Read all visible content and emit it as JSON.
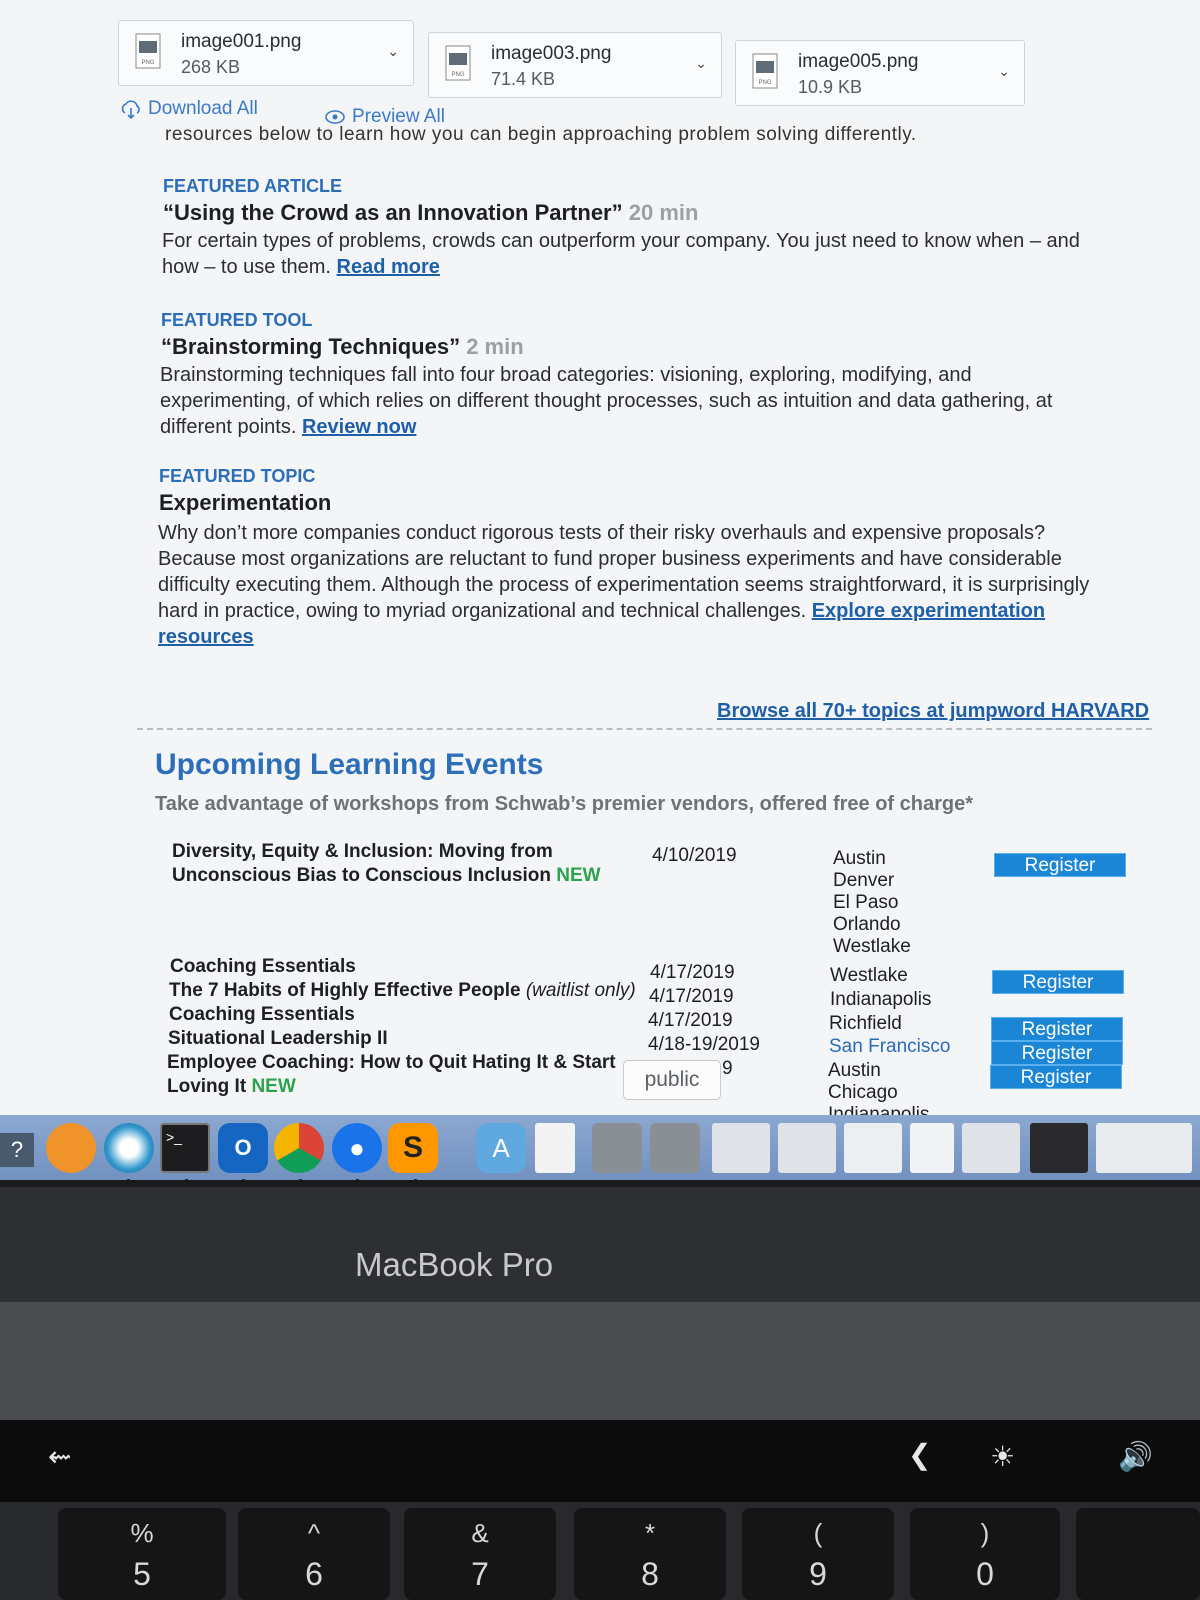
{
  "attachments": [
    {
      "name": "image001.png",
      "size": "268 KB",
      "type": "PNG"
    },
    {
      "name": "image003.png",
      "size": "71.4 KB",
      "type": "PNG"
    },
    {
      "name": "image005.png",
      "size": "10.9 KB",
      "type": "PNG"
    }
  ],
  "attachment_actions": {
    "download_all": "Download All",
    "preview_all": "Preview All"
  },
  "cut_line": "resources below to learn how you can begin approaching problem solving differently.",
  "featured": [
    {
      "label": "FEATURED ARTICLE",
      "title": "“Using the Crowd as an Innovation Partner”",
      "duration": "20 min",
      "body_lines": [
        "For certain types of problems, crowds can outperform your company. You just need to know when – and",
        "how – to use them."
      ],
      "link": "Read more"
    },
    {
      "label": "FEATURED TOOL",
      "title": "“Brainstorming Techniques”",
      "duration": "2 min",
      "body_lines": [
        "Brainstorming techniques fall into four broad categories: visioning, exploring, modifying, and",
        "experimenting, of which relies on different thought processes, such as intuition and data gathering, at",
        "different points."
      ],
      "link": "Review now"
    },
    {
      "label": "FEATURED TOPIC",
      "title": "Experimentation",
      "duration": "",
      "body_lines": [
        "Why don’t more companies conduct rigorous tests of their risky overhauls and expensive proposals?",
        "Because most organizations are reluctant to fund proper business experiments and have considerable",
        "difficulty executing them. Although the process of experimentation seems straightforward, it is surprisingly",
        "hard in practice, owing to myriad organizational and technical challenges."
      ],
      "link": "Explore experimentation",
      "link_cont": "resources"
    }
  ],
  "browse_link": "Browse all 70+ topics at jumpword HARVARD",
  "events": {
    "title": "Upcoming Learning Events",
    "subtitle": "Take advantage of workshops from Schwab’s premier vendors, offered free of charge*",
    "register_label": "Register",
    "new_label": "NEW",
    "rows": [
      {
        "name_lines": [
          "Diversity, Equity & Inclusion: Moving from",
          "Unconscious Bias to Conscious Inclusion"
        ],
        "new": true,
        "date": "4/10/2019",
        "cities": [
          "Austin",
          "Denver",
          "El Paso",
          "Orlando",
          "Westlake"
        ],
        "register": true
      },
      {
        "name_lines": [
          "Coaching Essentials"
        ],
        "new": false,
        "date": "4/17/2019",
        "cities": [
          "Westlake"
        ],
        "register": true
      },
      {
        "name_lines": [
          "The 7 Habits of Highly Effective People"
        ],
        "waitlist": "(waitlist only)",
        "new": false,
        "date": "4/17/2019",
        "cities": [
          "Indianapolis"
        ],
        "register": false
      },
      {
        "name_lines": [
          "Coaching Essentials"
        ],
        "new": false,
        "date": "4/17/2019",
        "cities": [
          "Richfield"
        ],
        "register": true
      },
      {
        "name_lines": [
          "Situational Leadership II"
        ],
        "new": false,
        "date": "4/18-19/2019",
        "cities": [
          "San Francisco"
        ],
        "register": true
      },
      {
        "name_lines": [
          "Employee Coaching: How to Quit Hating It & Start",
          "Loving It"
        ],
        "new": true,
        "date": "9",
        "cities": [
          "Austin",
          "Chicago",
          "Indianapolis"
        ],
        "register": true
      }
    ],
    "tooltip": "public"
  },
  "dock_apps": [
    "help-icon",
    "books-icon",
    "photos-icon",
    "terminal-icon",
    "outlook-icon",
    "chrome-icon",
    "maps-pin-icon",
    "sublime-icon",
    "app-store-folder-icon",
    "doc-icon",
    "drive-icon",
    "drive-icon",
    "window-thumbnail-icon",
    "window-thumbnail-icon",
    "window-thumbnail-icon",
    "window-thumbnail-icon",
    "window-thumbnail-icon",
    "window-thumbnail-icon",
    "window-thumbnail-icon"
  ],
  "device_label": "MacBook Pro",
  "keys": [
    {
      "up": "%",
      "down": "5"
    },
    {
      "up": "^",
      "down": "6"
    },
    {
      "up": "&",
      "down": "7"
    },
    {
      "up": "*",
      "down": "8"
    },
    {
      "up": "(",
      "down": "9"
    },
    {
      "up": ")",
      "down": "0"
    }
  ],
  "colors": {
    "link": "#1f5fa8",
    "section_label": "#2c6fb8",
    "new": "#2ba24c",
    "register": "#1b86d6"
  }
}
